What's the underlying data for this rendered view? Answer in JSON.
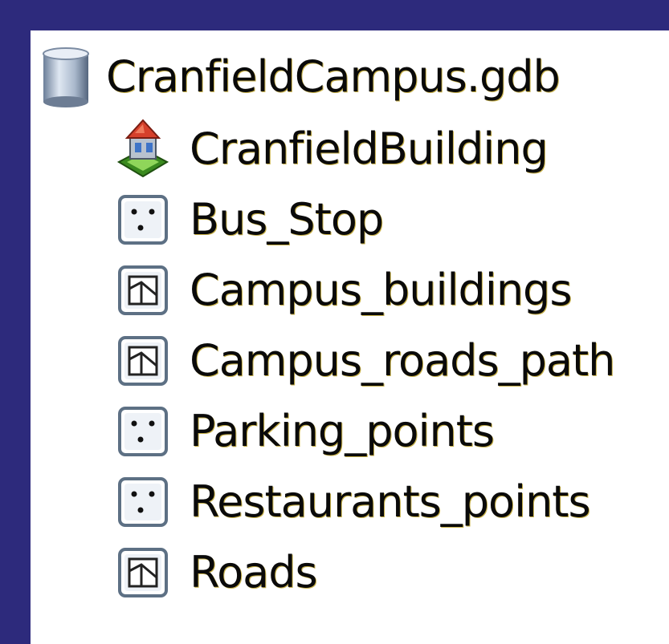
{
  "geodatabase": {
    "name": "CranfieldCampus.gdb",
    "icon": "database-cylinder-icon",
    "items": [
      {
        "label": "CranfieldBuilding",
        "icon": "topology-building-icon"
      },
      {
        "label": "Bus_Stop",
        "icon": "point-feature-class-icon"
      },
      {
        "label": "Campus_buildings",
        "icon": "polygon-feature-class-icon"
      },
      {
        "label": "Campus_roads_path",
        "icon": "polygon-feature-class-icon"
      },
      {
        "label": "Parking_points",
        "icon": "point-feature-class-icon"
      },
      {
        "label": "Restaurants_points",
        "icon": "point-feature-class-icon"
      },
      {
        "label": "Roads",
        "icon": "polygon-feature-class-icon"
      }
    ]
  }
}
